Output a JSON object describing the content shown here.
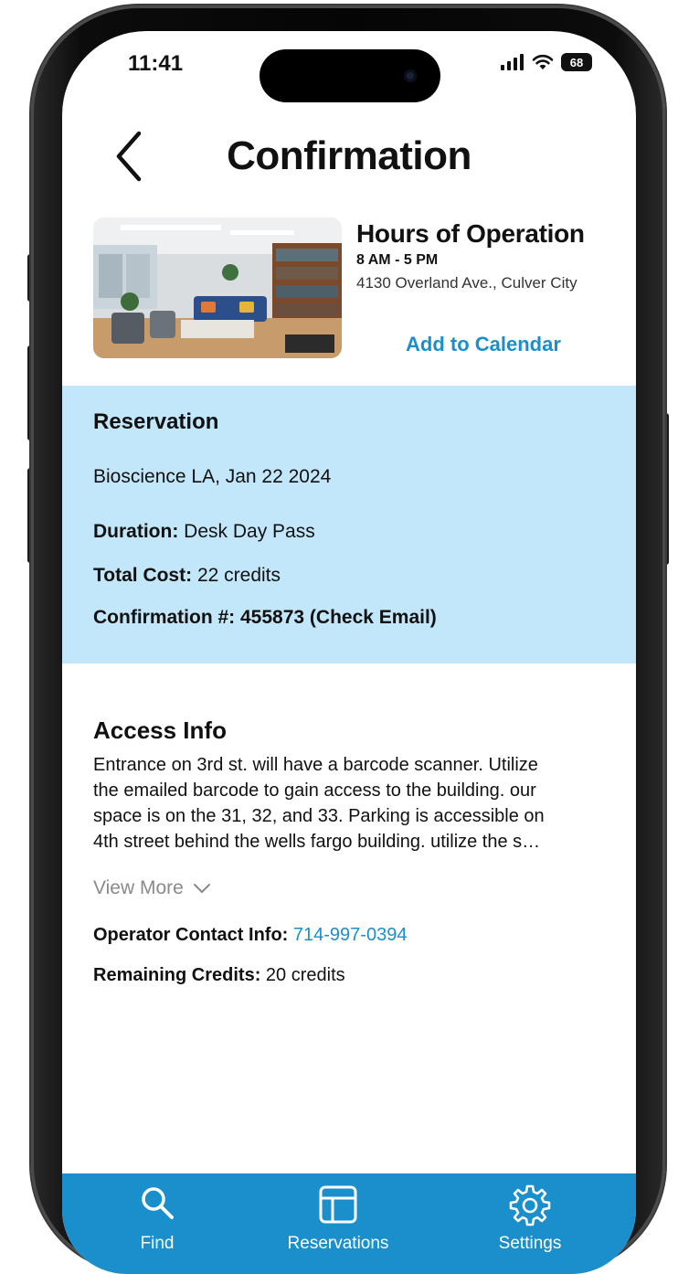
{
  "status_bar": {
    "time": "11:41",
    "battery": "68"
  },
  "header": {
    "title": "Confirmation"
  },
  "location": {
    "title": "Hours of Operation",
    "hours": "8 AM - 5 PM",
    "address": "4130 Overland Ave., Culver City",
    "calendar_link": "Add to Calendar"
  },
  "reservation": {
    "heading": "Reservation",
    "place_date": "Bioscience LA, Jan 22 2024",
    "duration_label": "Duration:",
    "duration_value": "Desk Day Pass",
    "cost_label": "Total Cost:",
    "cost_value": "22 credits",
    "confirmation": "Confirmation #: 455873 (Check Email)"
  },
  "access": {
    "heading": "Access Info",
    "lines": [
      "Entrance on 3rd st. will have a barcode scanner. Utilize",
      "the emailed barcode to gain access to the building. our",
      "space is on the 31, 32, and 33. Parking is accessible on",
      "4th street behind the wells fargo building. utilize the s…"
    ],
    "view_more": "View More",
    "operator_label": "Operator Contact Info:",
    "operator_phone": "714-997-0394",
    "credits_label": "Remaining Credits:",
    "credits_value": "20 credits"
  },
  "tabs": [
    {
      "label": "Find",
      "icon": "search-icon"
    },
    {
      "label": "Reservations",
      "icon": "layout-icon"
    },
    {
      "label": "Settings",
      "icon": "gear-icon"
    }
  ],
  "colors": {
    "accent": "#1a8fcb",
    "panel": "#c3e7fa"
  }
}
